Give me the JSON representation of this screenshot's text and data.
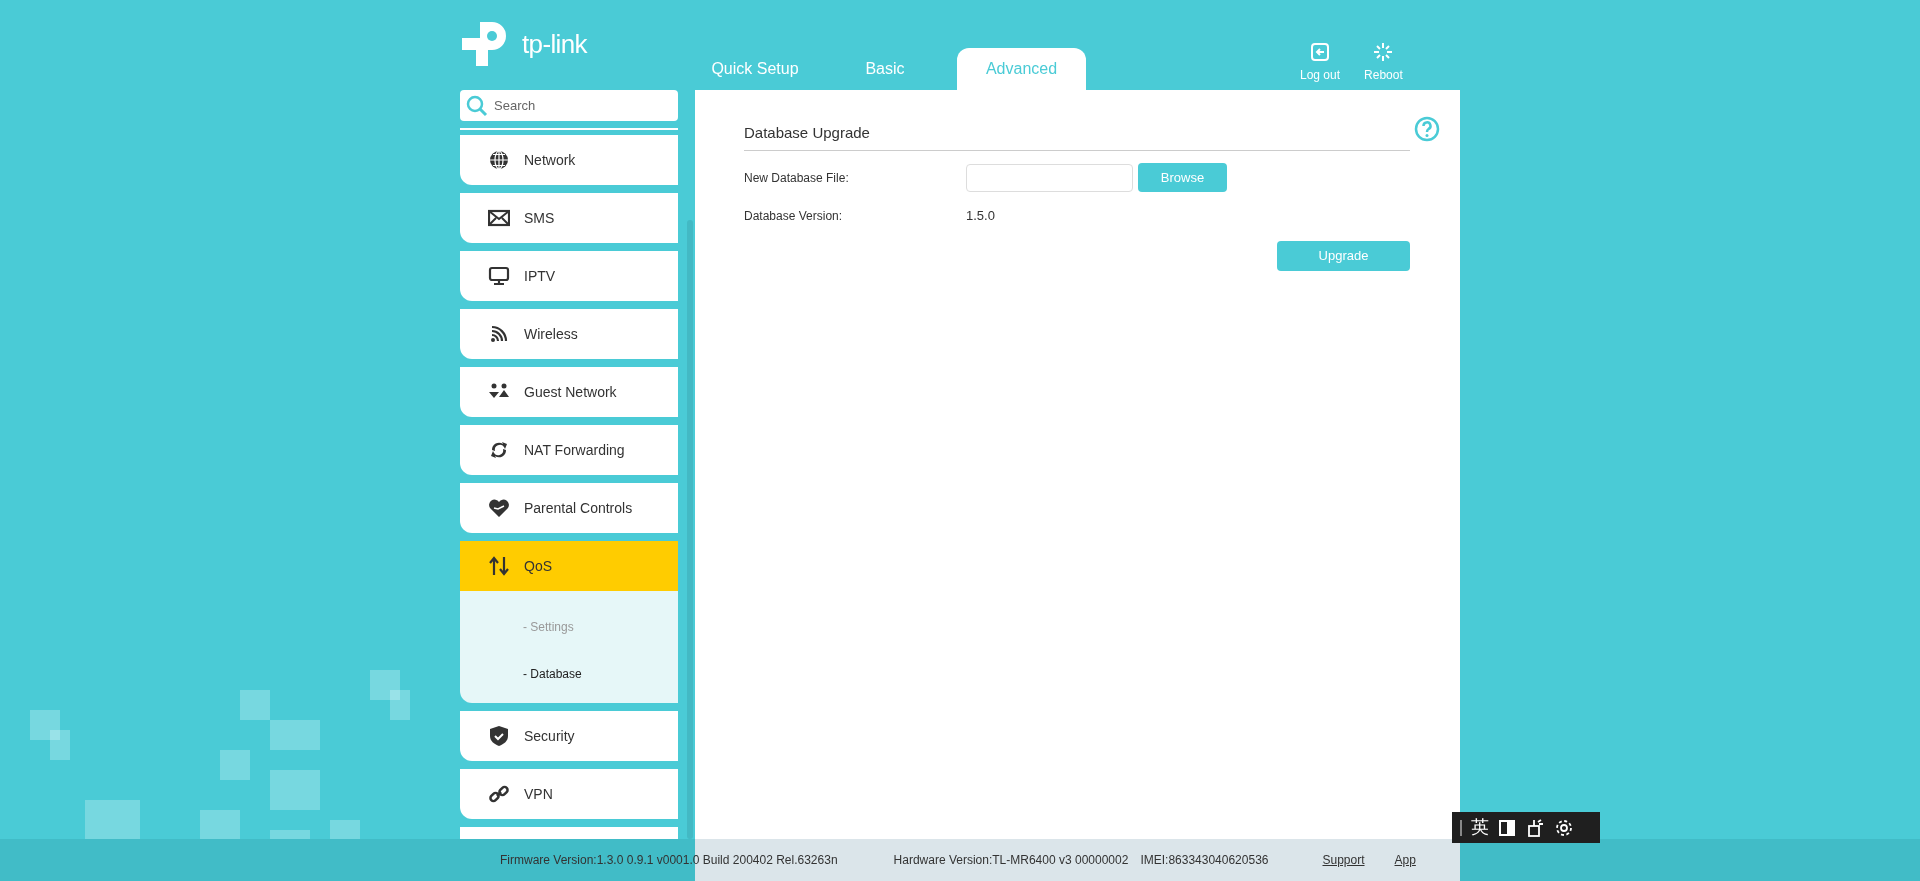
{
  "header": {
    "logo": "tp-link",
    "tabs": [
      {
        "label": "Quick Setup",
        "selected": false
      },
      {
        "label": "Basic",
        "selected": false
      },
      {
        "label": "Advanced",
        "selected": true
      }
    ],
    "actions": [
      {
        "kind": "logout",
        "label": "Log out"
      },
      {
        "kind": "reboot",
        "label": "Reboot"
      }
    ]
  },
  "sidebar": {
    "search": {
      "placeholder": "Search"
    },
    "items": [
      {
        "label": "Network",
        "selected": false,
        "expanded": false
      },
      {
        "label": "SMS",
        "selected": false,
        "expanded": false
      },
      {
        "label": "IPTV",
        "selected": false,
        "expanded": false
      },
      {
        "label": "Wireless",
        "selected": false,
        "expanded": false
      },
      {
        "label": "Guest Network",
        "selected": false,
        "expanded": false
      },
      {
        "label": "NAT Forwarding",
        "selected": false,
        "expanded": false
      },
      {
        "label": "Parental Controls",
        "selected": false,
        "expanded": false
      },
      {
        "label": "QoS",
        "selected": true,
        "expanded": true,
        "children": [
          {
            "label": "- Settings",
            "selected": false
          },
          {
            "label": "- Database",
            "selected": true
          }
        ]
      },
      {
        "label": "Security",
        "selected": false,
        "expanded": false
      },
      {
        "label": "VPN",
        "selected": false,
        "expanded": false
      }
    ]
  },
  "content": {
    "title": "Database Upgrade",
    "fields": [
      {
        "kind": "file",
        "label": "New Database File:",
        "button": "Browse"
      },
      {
        "kind": "text",
        "label": "Database Version:",
        "value": "1.5.0"
      }
    ],
    "primary_button": "Upgrade"
  },
  "footer": {
    "firmware": "Firmware Version:1.3.0 0.9.1 v0001.0 Build 200402 Rel.63263n",
    "hardware": "Hardware Version:TL-MR6400 v3 00000002",
    "imei": "IMEI:863343040620536",
    "links": [
      "Support",
      "App"
    ]
  },
  "ime_toolbar": {
    "mode": "英"
  }
}
